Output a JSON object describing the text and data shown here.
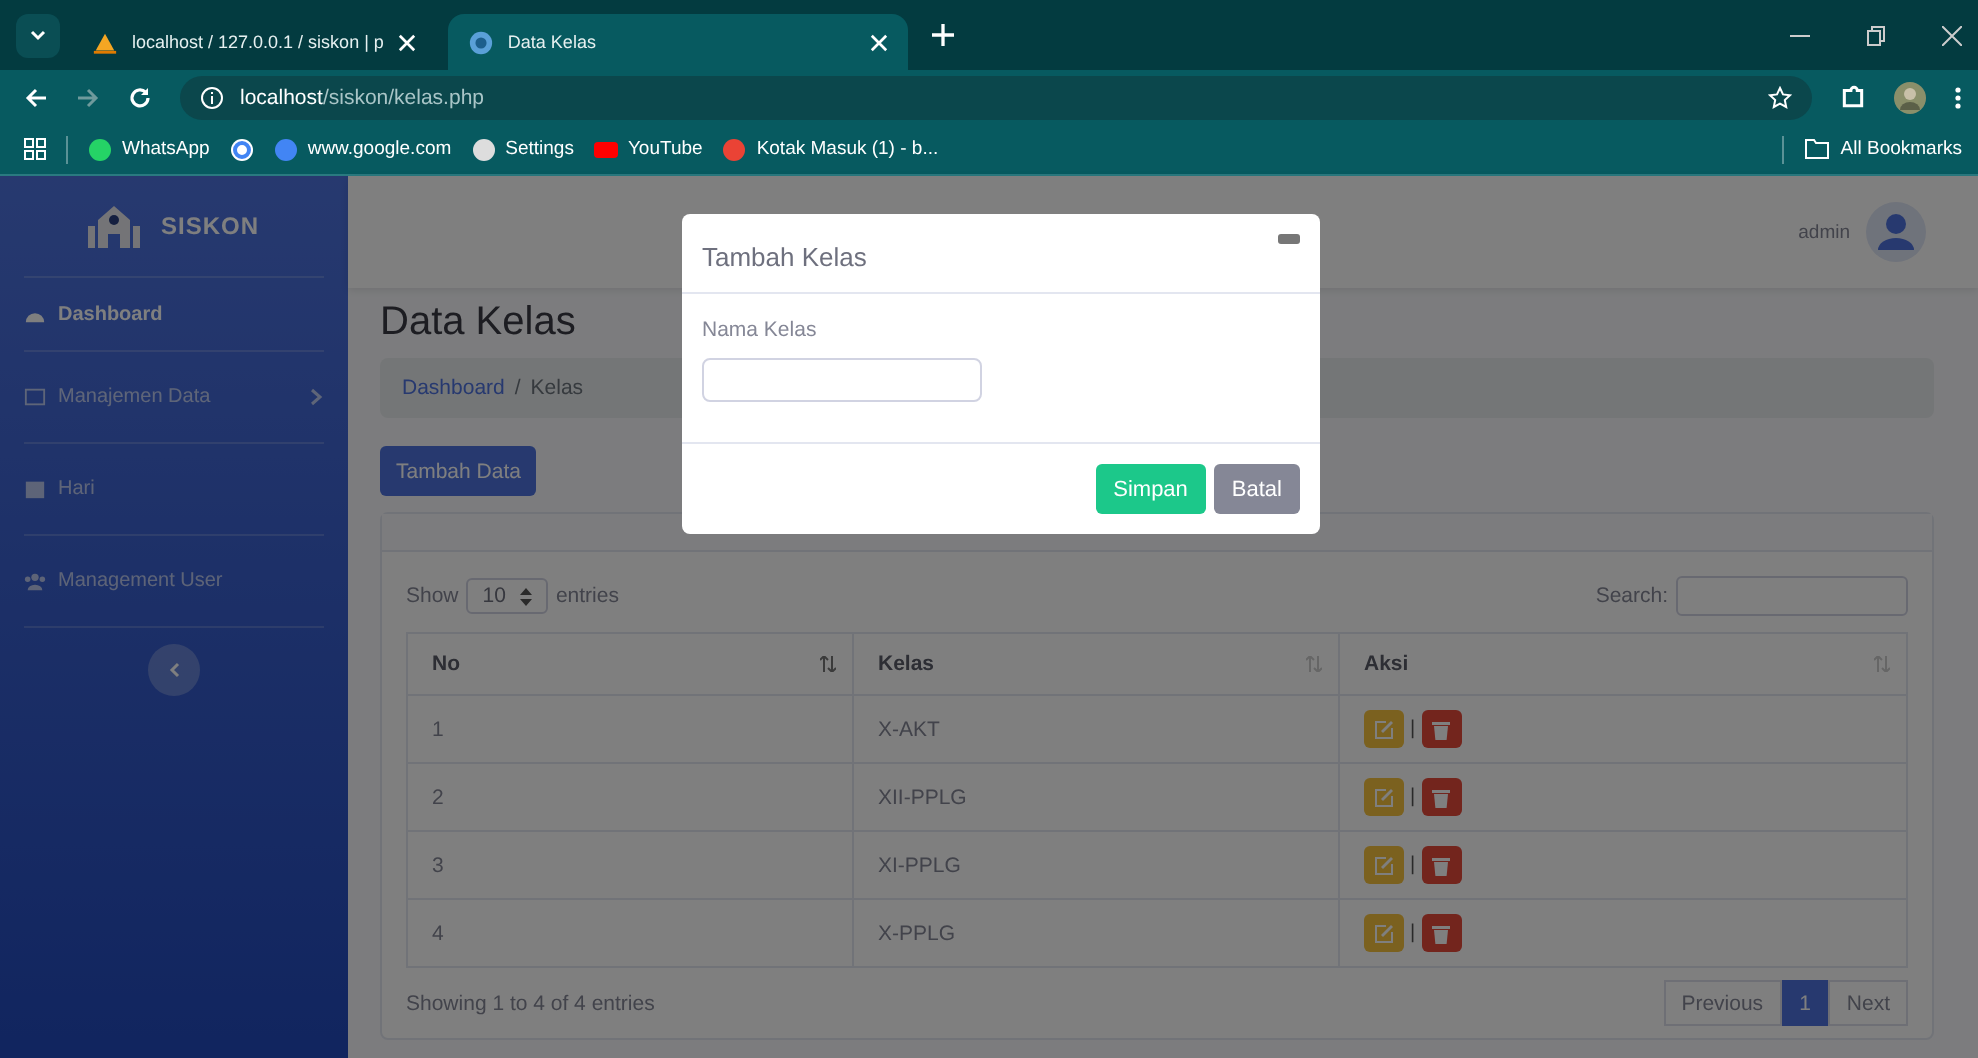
{
  "browser": {
    "tabs": [
      {
        "title": "localhost / 127.0.0.1 / siskon | p",
        "selected": false
      },
      {
        "title": "Data Kelas",
        "selected": true
      }
    ],
    "url": {
      "host": "localhost",
      "path": "/siskon/kelas.php"
    },
    "bookmarks": [
      {
        "kind": "link",
        "label": "WhatsApp"
      },
      {
        "kind": "icon"
      },
      {
        "kind": "link",
        "label": "www.google.com"
      },
      {
        "kind": "link",
        "label": "Settings"
      },
      {
        "kind": "link",
        "label": "YouTube"
      },
      {
        "kind": "link",
        "label": "Kotak Masuk (1) - b..."
      }
    ],
    "all_bookmarks": "All Bookmarks"
  },
  "sidebar": {
    "brand": "SISKON",
    "items": [
      {
        "label": "Dashboard",
        "submenu": false
      },
      {
        "label": "Manajemen Data",
        "submenu": true
      },
      {
        "label": "Hari",
        "submenu": false
      },
      {
        "label": "Management User",
        "submenu": false
      }
    ]
  },
  "topbar": {
    "user": "admin"
  },
  "page": {
    "title": "Data Kelas",
    "breadcrumb_separator": "/",
    "breadcrumb": [
      {
        "label": "Dashboard",
        "link": true
      },
      {
        "label": "Kelas",
        "link": false
      }
    ],
    "add_button": "Tambah Data",
    "table": {
      "show": "Show",
      "length": "10",
      "entries": "entries",
      "search_label": "Search:",
      "action_separator": "|",
      "columns": [
        "No",
        "Kelas",
        "Aksi"
      ],
      "rows": [
        {
          "no": "1",
          "kelas": "X-AKT"
        },
        {
          "no": "2",
          "kelas": "XII-PPLG"
        },
        {
          "no": "3",
          "kelas": "XI-PPLG"
        },
        {
          "no": "4",
          "kelas": "X-PPLG"
        }
      ],
      "info": "Showing 1 to 4 of 4 entries",
      "pagination": {
        "previous": "Previous",
        "pages": [
          {
            "label": "1",
            "selected": true
          }
        ],
        "next": "Next"
      }
    }
  },
  "modal": {
    "title": "Tambah Kelas",
    "field_label": "Nama Kelas",
    "buttons": [
      {
        "label": "Simpan",
        "kind": "primary"
      },
      {
        "label": "Batal",
        "kind": "secondary"
      }
    ]
  }
}
